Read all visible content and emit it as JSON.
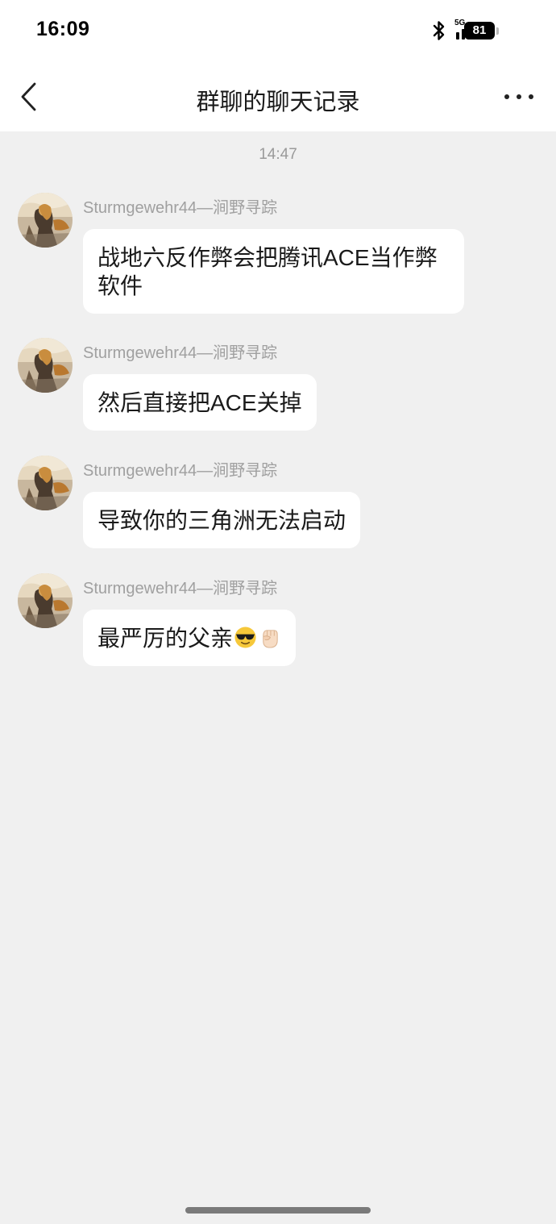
{
  "status": {
    "time": "16:09",
    "network": "5G",
    "battery": "81"
  },
  "header": {
    "title": "群聊的聊天记录",
    "back_icon": "chevron-left-icon",
    "more_icon": "more-horizontal-icon"
  },
  "chat": {
    "timestamp": "14:47",
    "messages": [
      {
        "sender": "Sturmgewehr44—涧野寻踪",
        "text": "战地六反作弊会把腾讯ACE当作弊软件"
      },
      {
        "sender": "Sturmgewehr44—涧野寻踪",
        "text": "然后直接把ACE关掉"
      },
      {
        "sender": "Sturmgewehr44—涧野寻踪",
        "text": "导致你的三角洲无法启动"
      },
      {
        "sender": "Sturmgewehr44—涧野寻踪",
        "text": "最严厉的父亲",
        "emojis": [
          "sunglasses-face-emoji",
          "raised-fist-emoji"
        ]
      }
    ]
  }
}
